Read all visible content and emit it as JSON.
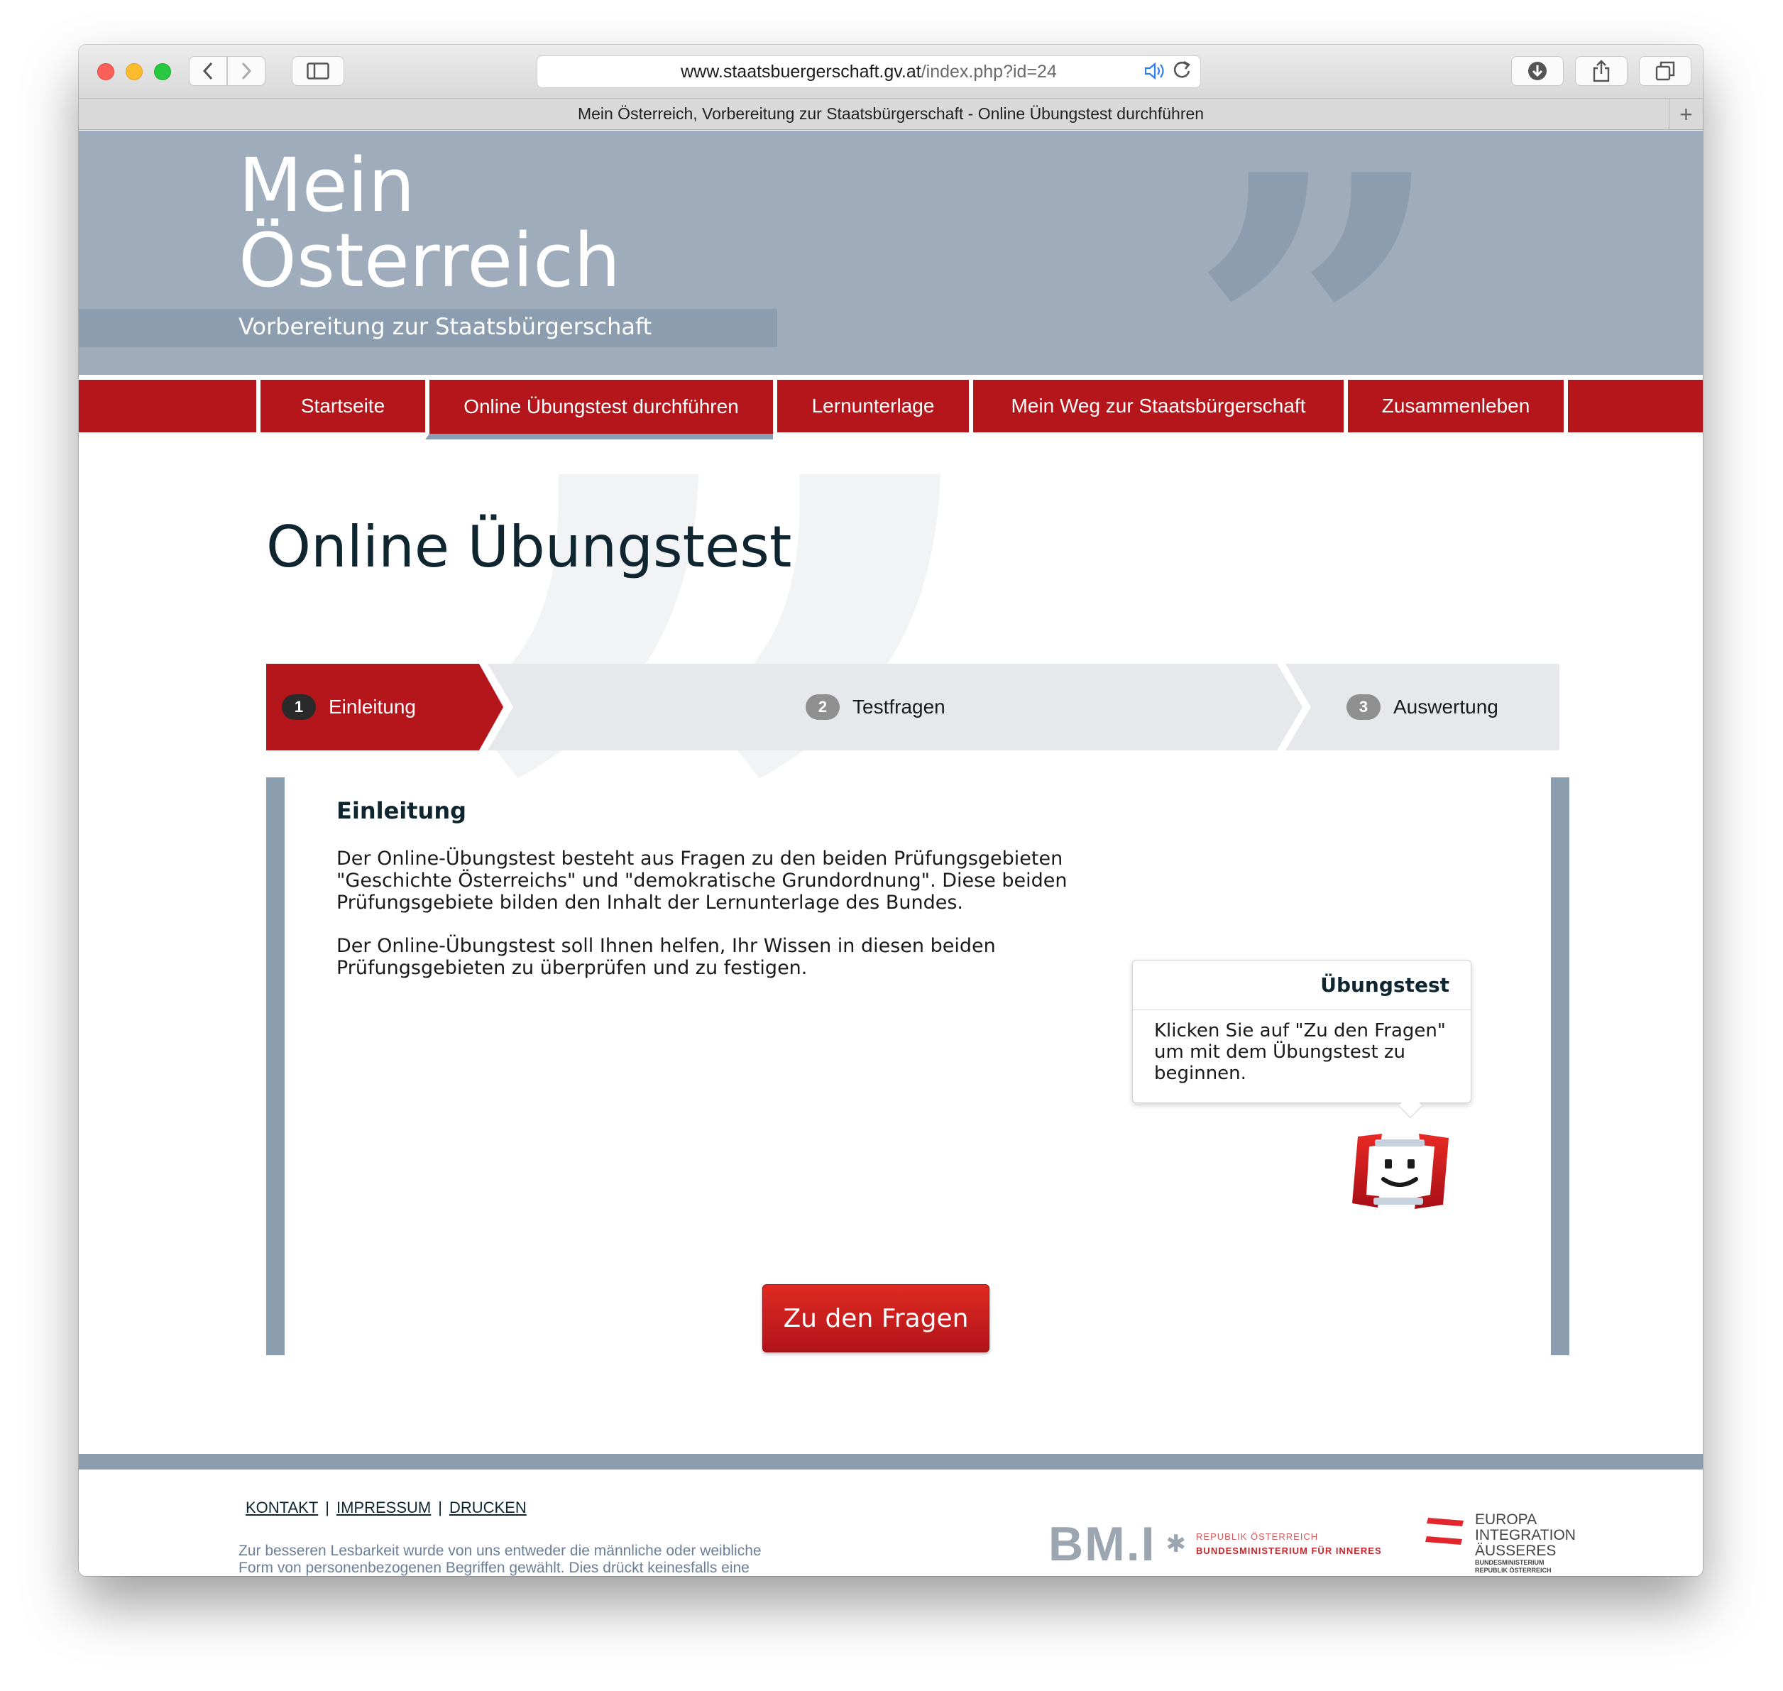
{
  "browser": {
    "url_host": "www.staatsbuergerschaft.gv.at",
    "url_path": "/index.php?id=24",
    "tab_title": "Mein Österreich, Vorbereitung zur Staatsbürgerschaft - Online Übungstest durchführen",
    "icons": {
      "back": "chevron-left-icon",
      "forward": "chevron-right-icon",
      "sidebar": "sidebar-icon",
      "audio": "speaker-icon",
      "reload": "reload-icon",
      "download": "download-icon",
      "share": "share-icon",
      "tabs": "tabs-icon",
      "new_tab": "plus-icon"
    }
  },
  "header": {
    "title_line1": "Mein",
    "title_line2": "Österreich",
    "tagline": "Vorbereitung zur Staatsbürgerschaft"
  },
  "nav": {
    "items": [
      {
        "label": "Startseite",
        "active": false
      },
      {
        "label": "Online Übungstest durchführen",
        "active": true
      },
      {
        "label": "Lernunterlage",
        "active": false
      },
      {
        "label": "Mein Weg zur Staatsbürgerschaft",
        "active": false
      },
      {
        "label": "Zusammenleben",
        "active": false
      }
    ]
  },
  "main": {
    "title": "Online Übungstest",
    "steps": [
      {
        "num": "1",
        "label": "Einleitung",
        "active": true
      },
      {
        "num": "2",
        "label": "Testfragen",
        "active": false
      },
      {
        "num": "3",
        "label": "Auswertung",
        "active": false
      }
    ],
    "intro_heading": "Einleitung",
    "paragraphs": [
      "Der Online-Übungstest besteht aus Fragen zu den beiden Prüfungsgebieten \"Geschichte Österreichs\" und \"demokratische Grundordnung\". Diese beiden Prüfungsgebiete bilden den Inhalt der Lernunterlage des Bundes.",
      "Der Online-Übungstest soll Ihnen helfen, Ihr Wissen in diesen beiden Prüfungsgebieten zu überprüfen und zu festigen."
    ],
    "bubble": {
      "title": "Übungstest",
      "text": "Klicken Sie auf \"Zu den Fragen\" um mit dem Übungstest zu beginnen."
    },
    "cta_label": "Zu den Fragen"
  },
  "footer": {
    "links": [
      "KONTAKT",
      "IMPRESSUM",
      "DRUCKEN"
    ],
    "separator": "|",
    "disclaimer": "Zur besseren Lesbarkeit wurde von uns entweder die männliche oder weibliche Form von personenbezogenen Begriffen gewählt. Dies drückt keinesfalls eine Benachteiligung des jeweils anderen Geschlechts aus.",
    "bmi": {
      "mark": "BM.I",
      "line1": "REPUBLIK ÖSTERREICH",
      "line2": "BUNDESMINISTERIUM FÜR INNERES"
    },
    "eia": {
      "line1": "EUROPA",
      "line2": "INTEGRATION",
      "line3": "ÄUSSERES",
      "line4": "BUNDESMINISTERIUM",
      "line5": "REPUBLIK ÖSTERREICH"
    }
  },
  "colors": {
    "brand_red": "#b5161b",
    "header_blue_grey": "#9eacbb",
    "accent_grey": "#8d9db0",
    "title_dark": "#0f2630"
  }
}
